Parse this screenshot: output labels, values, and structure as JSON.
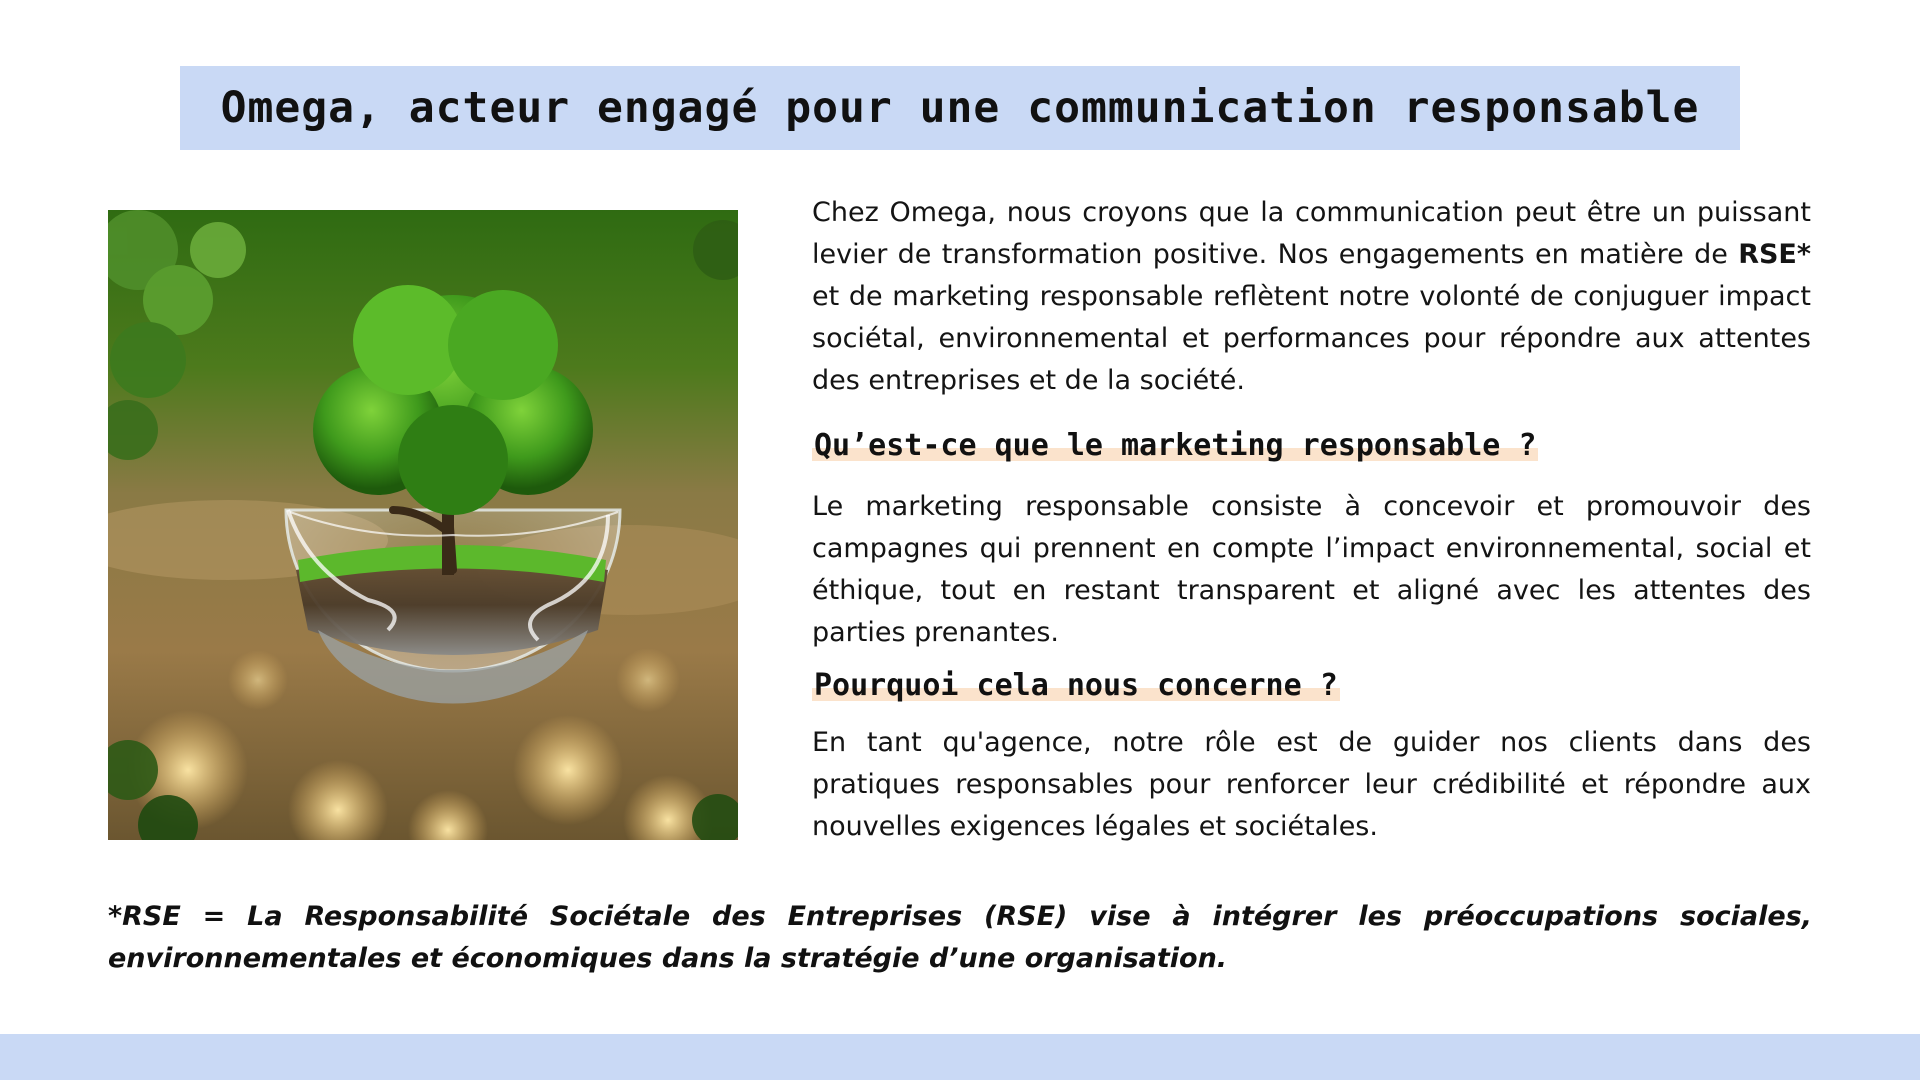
{
  "title": "Omega, acteur engagé pour une communication responsable",
  "intro": {
    "before": "Chez Omega, nous croyons que la communication peut être un puissant levier de transformation positive. Nos engagements en matière de ",
    "bold": "RSE*",
    "after": " et de marketing responsable reflètent notre volonté de conjuguer impact sociétal, environnemental et performances pour répondre aux attentes des entreprises et de la société."
  },
  "section1": {
    "heading": "Qu’est-ce que le marketing responsable ?",
    "text": "Le marketing responsable consiste à concevoir et promouvoir des campagnes qui prennent en compte l’impact environnemental, social et éthique, tout en restant transparent et aligné avec les attentes des parties prenantes."
  },
  "section2": {
    "heading": "Pourquoi cela nous concerne ?",
    "text": "En tant qu'agence, notre rôle est de guider nos clients dans des pratiques responsables pour renforcer leur crédibilité et répondre aux nouvelles exigences légales et sociétales."
  },
  "footnote": "*RSE = La Responsabilité Sociétale des Entreprises (RSE) vise à intégrer les préoccupations sociales, environnementales et économiques dans la stratégie d’une organisation.",
  "colors": {
    "band": "#c9d9f5",
    "highlight": "#fbe3cc"
  }
}
